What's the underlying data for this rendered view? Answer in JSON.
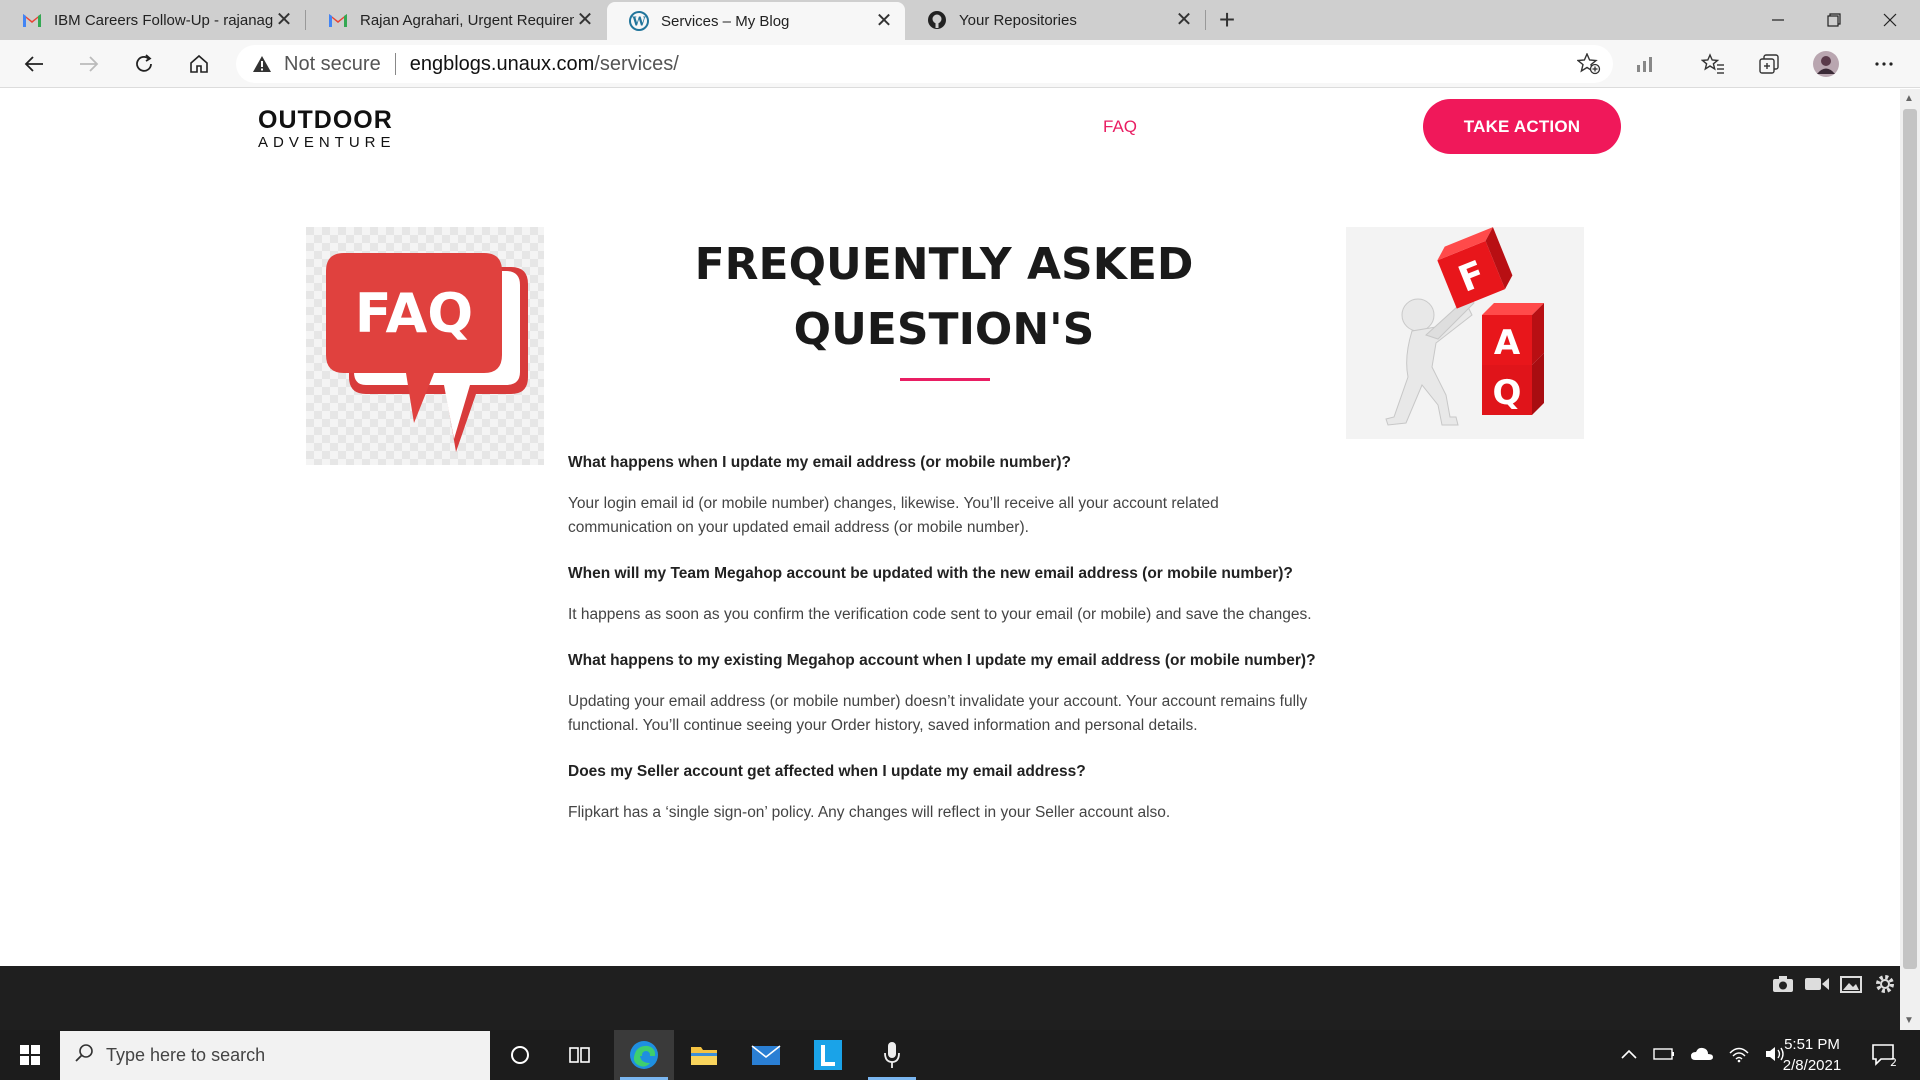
{
  "browser": {
    "tabs": [
      {
        "title": "IBM Careers Follow-Up - rajanag",
        "icon": "gmail-icon"
      },
      {
        "title": "Rajan Agrahari, Urgent Requirem",
        "icon": "gmail-icon"
      },
      {
        "title": "Services – My Blog",
        "icon": "wordpress-icon"
      },
      {
        "title": "Your Repositories",
        "icon": "github-icon"
      }
    ],
    "close_glyph": "✕",
    "new_tab_glyph": "+",
    "address": {
      "security_label": "Not secure",
      "host": "engblogs.unaux.com",
      "path": "/services/"
    }
  },
  "site": {
    "logo_line1": "OUTDOOR",
    "logo_line2": "ADVENTURE",
    "nav_faq": "FAQ",
    "cta_label": "TAKE ACTION",
    "heading_line1": "FREQUENTLY ASKED",
    "heading_line2": "QUESTION'S",
    "left_image_text": "FAQ",
    "right_image_letters": [
      "F",
      "A",
      "Q"
    ],
    "faqs": [
      {
        "question": "What happens when I update my email address (or mobile number)?",
        "answer": "Your login email id (or mobile number) changes, likewise. You’ll receive all your account related communication on your updated email address (or mobile number)."
      },
      {
        "question": "When will my Team Megahop account be updated with the new email address (or mobile number)?",
        "answer": "It happens as soon as you confirm the verification code sent to your email (or mobile) and save the changes."
      },
      {
        "question": "What happens to my existing Megahop account when I update my email address (or mobile number)?",
        "answer": "Updating your email address (or mobile number) doesn’t invalidate your account. Your account remains fully functional. You’ll continue seeing your Order history, saved information and personal details."
      },
      {
        "question": "Does my Seller account get affected when I update my email address?",
        "answer": "Flipkart has a ‘single sign-on’ policy. Any changes will reflect in your Seller account also."
      }
    ]
  },
  "taskbar": {
    "search_placeholder": "Type here to search",
    "time": "5:51 PM",
    "date": "2/8/2021",
    "notification_count": "2"
  },
  "colors": {
    "accent": "#e91e63",
    "cta": "#f0185a",
    "footer": "#1f1f1f",
    "taskbar": "#1c1c1c"
  }
}
